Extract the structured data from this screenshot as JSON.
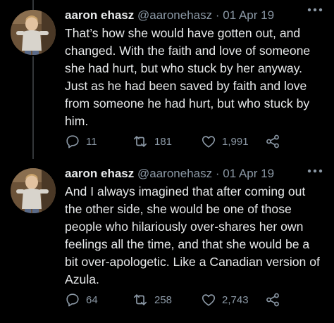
{
  "tweets": [
    {
      "author": {
        "display_name": "aaron ehasz",
        "handle": "@aaronehasz"
      },
      "separator": "·",
      "date": "01 Apr 19",
      "text": "That’s how she would have gotten out, and changed. With the faith and love of someone she had hurt, but who stuck by her anyway. Just as he had been saved by faith and love from someone he had hurt, but who stuck by him.",
      "stats": {
        "replies": "11",
        "retweets": "181",
        "likes": "1,991"
      }
    },
    {
      "author": {
        "display_name": "aaron ehasz",
        "handle": "@aaronehasz"
      },
      "separator": "·",
      "date": "01 Apr 19",
      "text": "And I always imagined that after coming out the other side, she would be one of those people who hilariously over-shares her own feelings all the time, and that she would be a bit over-apologetic. Like a Canadian version of Azula.",
      "stats": {
        "replies": "64",
        "retweets": "258",
        "likes": "2,743"
      }
    }
  ],
  "icons": {
    "reply": "reply-icon",
    "retweet": "retweet-icon",
    "like": "heart-icon",
    "share": "share-icon",
    "more": "more-icon"
  },
  "colors": {
    "background": "#000000",
    "text": "#e7e9ea",
    "secondary_text": "#8b98a5",
    "thread_line": "#333639"
  }
}
